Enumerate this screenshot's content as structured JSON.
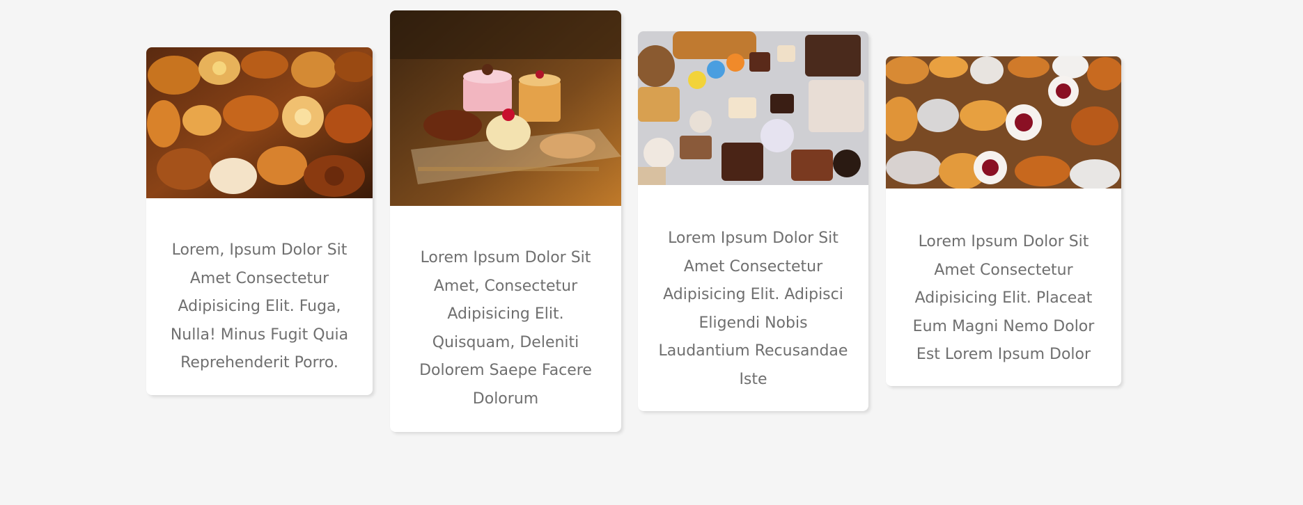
{
  "cards": [
    {
      "image": "assorted-breads-and-pastries-photo",
      "text": "Lorem, Ipsum Dolor Sit Amet Consectetur Adipisicing Elit. Fuga, Nulla! Minus Fugit Quia Reprehenderit Porro."
    },
    {
      "image": "cakes-on-glass-display-photo",
      "text": "Lorem Ipsum Dolor Sit Amet, Consectetur Adipisicing Elit. Quisquam, Deleniti Dolorem Saepe Facere Dolorum"
    },
    {
      "image": "cupcakes-and-pastries-flatlay-photo",
      "text": "Lorem Ipsum Dolor Sit Amet Consectetur Adipisicing Elit. Adipisci Eligendi Nobis Laudantium Recusandae Iste"
    },
    {
      "image": "croissants-and-jam-pastries-photo",
      "text": "Lorem Ipsum Dolor Sit Amet Consectetur Adipisicing Elit. Placeat Eum Magni Nemo Dolor Est Lorem Ipsum Dolor"
    }
  ],
  "colors": {
    "background": "#f5f5f5",
    "card": "#ffffff",
    "text": "#6f6f6f"
  }
}
